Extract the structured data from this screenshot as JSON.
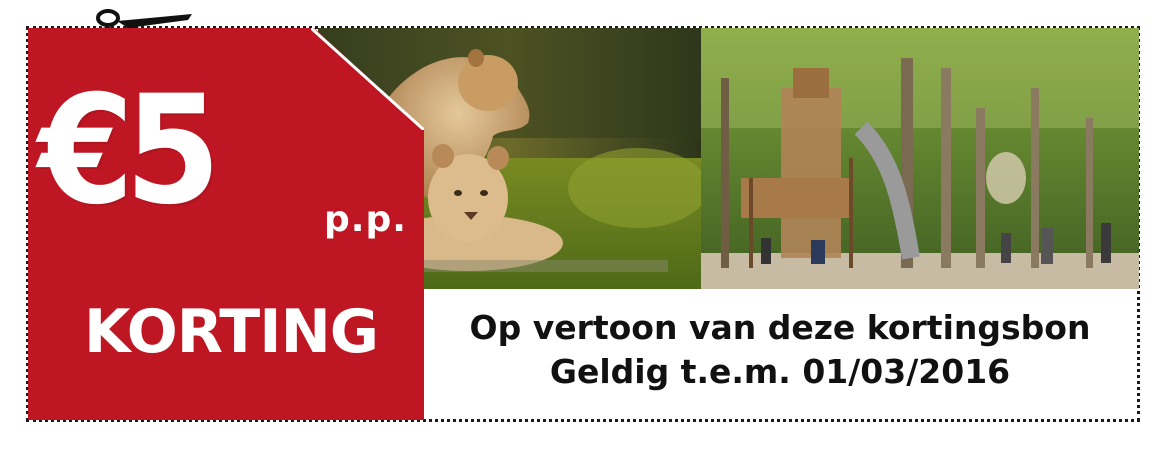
{
  "coupon": {
    "price": "€5",
    "per_person": "p.p.",
    "label": "KORTING",
    "condition": "Op vertoon van deze kortingsbon",
    "validity": "Geldig t.e.m. 01/03/2016"
  },
  "icons": {
    "scissors": "scissors-icon"
  },
  "images": {
    "left": "lions-photo",
    "right": "playground-photo"
  },
  "colors": {
    "brand_red": "#be1622",
    "text_dark": "#111111",
    "border": "#1a1a1a"
  }
}
